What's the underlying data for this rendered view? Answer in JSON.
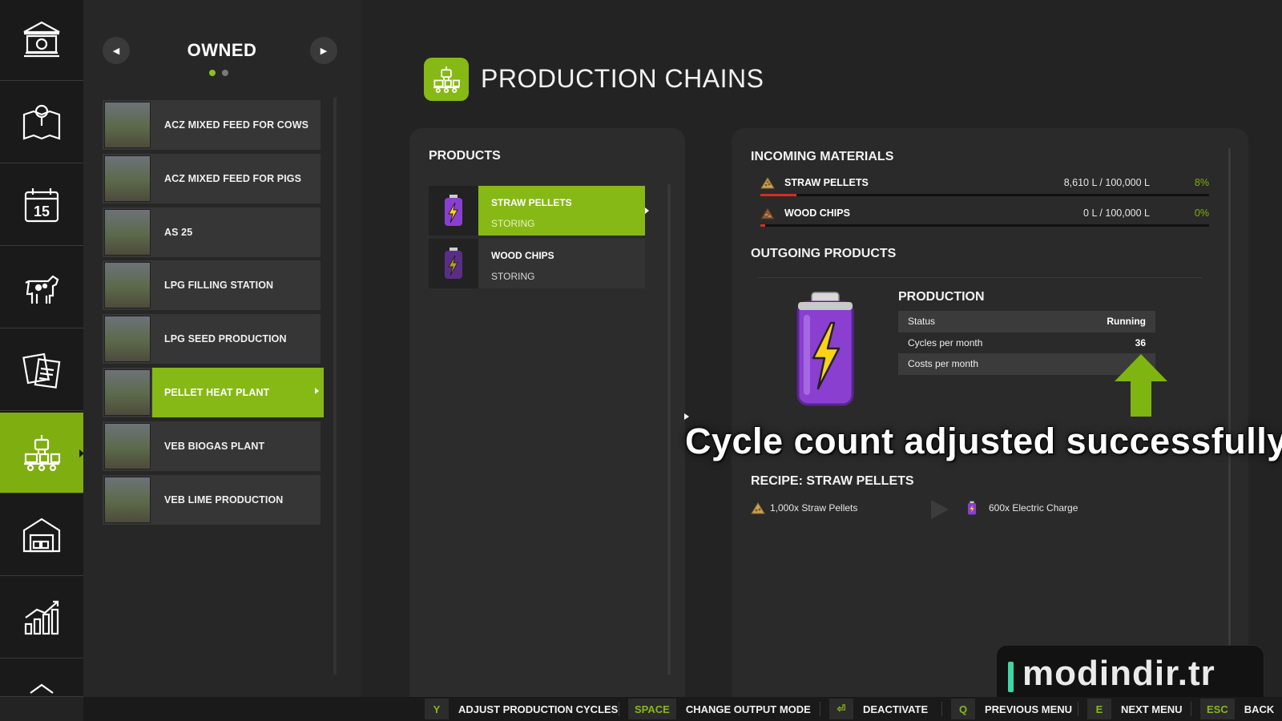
{
  "colors": {
    "accent": "#86b915",
    "accent_dark": "#7fae10",
    "warning_bar": "#d92c1e",
    "background": "#232323"
  },
  "rail": {
    "items": [
      {
        "icon": "bank-icon",
        "active": false
      },
      {
        "icon": "map-icon",
        "active": false
      },
      {
        "icon": "calendar-icon",
        "active": false
      },
      {
        "icon": "cow-icon",
        "active": false
      },
      {
        "icon": "contracts-icon",
        "active": false
      },
      {
        "icon": "production-icon",
        "active": true
      },
      {
        "icon": "warehouse-icon",
        "active": false
      },
      {
        "icon": "statistics-icon",
        "active": false
      }
    ],
    "calendar_day": "15"
  },
  "owned": {
    "title": "OWNED",
    "page_count": 2,
    "current_page": 1,
    "items": [
      {
        "label": "ACZ MIXED FEED FOR COWS",
        "active": false
      },
      {
        "label": "ACZ MIXED FEED FOR PIGS",
        "active": false
      },
      {
        "label": "AS 25",
        "active": false
      },
      {
        "label": "LPG FILLING STATION",
        "active": false
      },
      {
        "label": "LPG SEED PRODUCTION",
        "active": false
      },
      {
        "label": "PELLET HEAT PLANT",
        "active": true
      },
      {
        "label": "VEB BIOGAS PLANT",
        "active": false
      },
      {
        "label": "VEB LIME PRODUCTION",
        "active": false
      }
    ]
  },
  "header": {
    "title": "PRODUCTION CHAINS",
    "icon": "production-icon"
  },
  "products": {
    "heading": "PRODUCTS",
    "items": [
      {
        "name": "STRAW PELLETS",
        "mode": "STORING",
        "icon": "battery-icon",
        "active": true
      },
      {
        "name": "WOOD CHIPS",
        "mode": "STORING",
        "icon": "battery-icon",
        "active": false
      }
    ]
  },
  "incoming": {
    "heading": "INCOMING MATERIALS",
    "items": [
      {
        "name": "STRAW PELLETS",
        "amount": "8,610 L / 100,000 L",
        "percent": "8%",
        "fill": 0.08,
        "icon": "pellets-icon"
      },
      {
        "name": "WOOD CHIPS",
        "amount": "0 L / 100,000 L",
        "percent": "0%",
        "fill": 0.0,
        "icon": "woodchips-icon"
      }
    ]
  },
  "outgoing": {
    "heading": "OUTGOING PRODUCTS"
  },
  "production": {
    "heading": "PRODUCTION",
    "rows": [
      {
        "label": "Status",
        "value": "Running"
      },
      {
        "label": "Cycles per month",
        "value": "36"
      },
      {
        "label": "Costs per month",
        "value": "6"
      }
    ]
  },
  "toast": "Cycle count adjusted successfully",
  "recipe": {
    "heading": "RECIPE: STRAW PELLETS",
    "input": "1,000x Straw Pellets",
    "output": "600x Electric Charge"
  },
  "watermark": "modindir.tr",
  "hints": [
    {
      "key": "Y",
      "label": "ADJUST PRODUCTION CYCLES"
    },
    {
      "key": "SPACE",
      "label": "CHANGE OUTPUT MODE"
    },
    {
      "key": "⏎",
      "label": "DEACTIVATE"
    },
    {
      "key": "Q",
      "label": "PREVIOUS MENU"
    },
    {
      "key": "E",
      "label": "NEXT MENU"
    },
    {
      "key": "ESC",
      "label": "BACK"
    }
  ]
}
